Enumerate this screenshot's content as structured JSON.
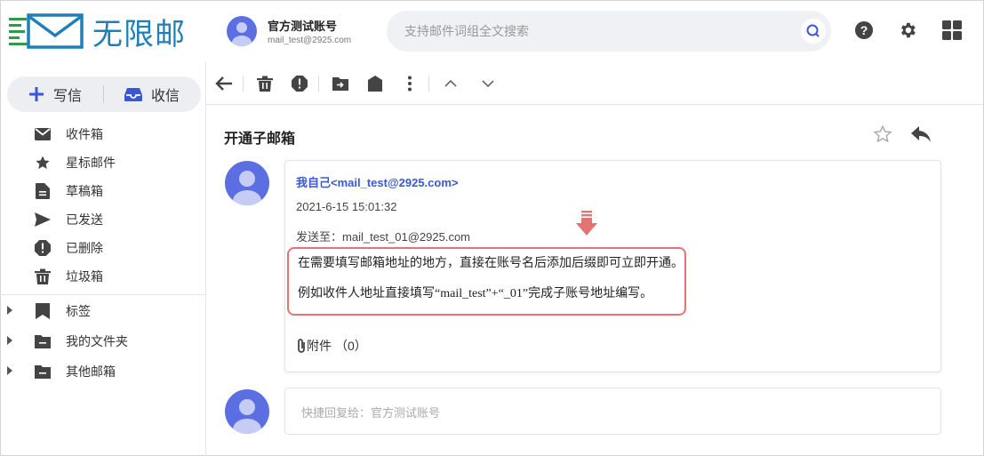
{
  "app": {
    "logo_text": "无限邮",
    "colors": {
      "brand": "#1f7fb8",
      "logo_green": "#2f9a4a",
      "accent": "#3a57d8",
      "avatar": "#5b6fe3",
      "highlight": "#e57373"
    }
  },
  "account": {
    "name": "官方测试账号",
    "email": "mail_test@2925.com"
  },
  "search": {
    "placeholder": "支持邮件词组全文搜索",
    "icon": "search-icon"
  },
  "header_icons": [
    "help-icon",
    "settings-icon",
    "apps-grid-icon"
  ],
  "compose": {
    "write_label": "写信",
    "receive_label": "收信"
  },
  "nav": {
    "items": [
      {
        "label": "收件箱",
        "icon": "inbox-icon"
      },
      {
        "label": "星标邮件",
        "icon": "star-icon"
      },
      {
        "label": "草稿箱",
        "icon": "draft-icon"
      },
      {
        "label": "已发送",
        "icon": "send-icon"
      },
      {
        "label": "已删除",
        "icon": "deleted-icon"
      },
      {
        "label": "垃圾箱",
        "icon": "trash-icon"
      }
    ],
    "groups": [
      {
        "label": "标签",
        "icon": "tag-icon"
      },
      {
        "label": "我的文件夹",
        "icon": "folder-icon"
      },
      {
        "label": "其他邮箱",
        "icon": "folder-icon"
      }
    ]
  },
  "toolbar": [
    "back-icon",
    "delete-icon",
    "report-icon",
    "move-icon",
    "tag-icon",
    "more-icon",
    "previous-icon",
    "next-icon"
  ],
  "mail": {
    "subject": "开通子邮箱",
    "sender": "我自己<mail_test@2925.com>",
    "date": "2021-6-15 15:01:32",
    "to_label": "发送至：",
    "to": "mail_test_01@2925.com",
    "body_line1": "在需要填写邮箱地址的地方，直接在账号名后添加后缀即可立即开通。",
    "body_line2": "例如收件人地址直接填写“mail_test”+“_01”完成子账号地址编写。",
    "attachment_label": "附件",
    "attachment_count": "（0）"
  },
  "quick_reply": {
    "placeholder": "快捷回复给：官方测试账号"
  }
}
